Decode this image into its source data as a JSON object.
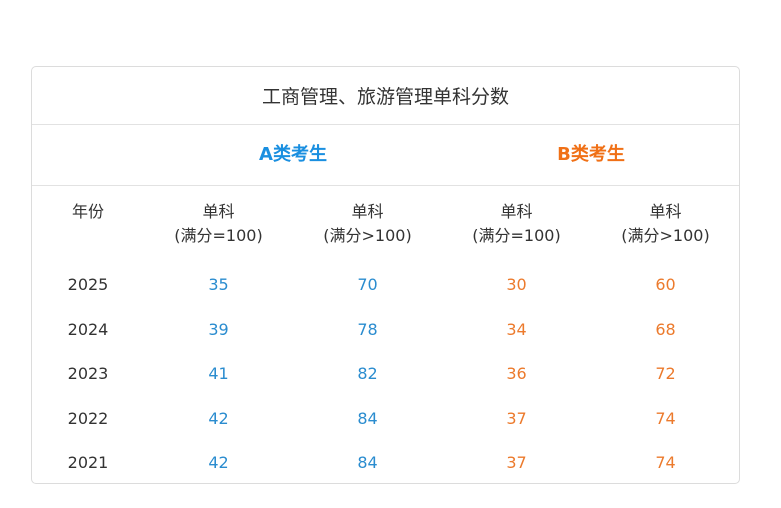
{
  "table": {
    "title": "工商管理、旅游管理单科分数",
    "group_a": "A类考生",
    "group_b": "B类考生",
    "headers": {
      "year": "年份",
      "col1": {
        "line1": "单科",
        "line2": "(满分=100)"
      },
      "col2": {
        "line1": "单科",
        "line2": "(满分>100)"
      },
      "col3": {
        "line1": "单科",
        "line2": "(满分=100)"
      },
      "col4": {
        "line1": "单科",
        "line2": "(满分>100)"
      }
    },
    "rows": [
      {
        "year": "2025",
        "a_eq100": "35",
        "a_gt100": "70",
        "b_eq100": "30",
        "b_gt100": "60"
      },
      {
        "year": "2024",
        "a_eq100": "39",
        "a_gt100": "78",
        "b_eq100": "34",
        "b_gt100": "68"
      },
      {
        "year": "2023",
        "a_eq100": "41",
        "a_gt100": "82",
        "b_eq100": "36",
        "b_gt100": "72"
      },
      {
        "year": "2022",
        "a_eq100": "42",
        "a_gt100": "84",
        "b_eq100": "37",
        "b_gt100": "74"
      },
      {
        "year": "2021",
        "a_eq100": "42",
        "a_gt100": "84",
        "b_eq100": "37",
        "b_gt100": "74"
      }
    ]
  },
  "colors": {
    "group_a": "#1a8fe0",
    "group_b": "#f07016",
    "a_values": "#2a8ccf",
    "b_values": "#ec7a2c"
  }
}
